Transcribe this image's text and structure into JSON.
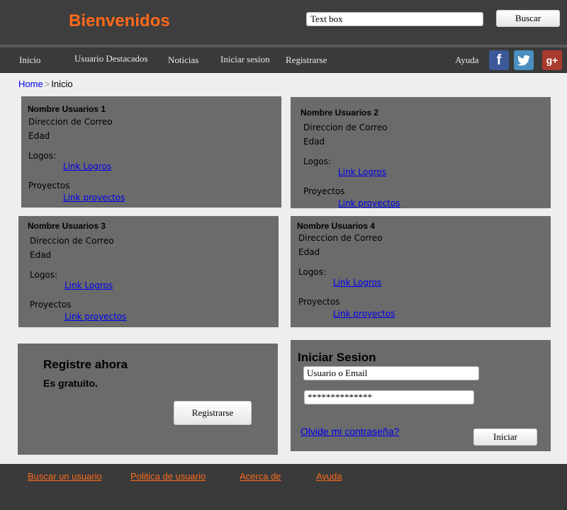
{
  "header": {
    "title": "Bienvenidos",
    "search_value": "Text box",
    "search_button": "Buscar"
  },
  "nav": {
    "items": [
      "Inicio",
      "Usuario Destacados",
      "Noticias",
      "Iniciar sesion",
      "Registrarse",
      "Ayuda"
    ],
    "social": {
      "facebook": "f",
      "twitter": "t",
      "googleplus": "g+"
    }
  },
  "breadcrumb": {
    "home": "Home",
    "separator": ">",
    "current": "Inicio"
  },
  "users": [
    {
      "name": "Nombre Usuarios 1",
      "email": "Direccion de Correo",
      "age": "Edad",
      "logros_label": "Logos:",
      "logros_link": "Link Logros",
      "proyectos_label": "Proyectos",
      "proyectos_link": "Link proyectos"
    },
    {
      "name": "Nombre Usuarios 2",
      "email": "Direccion de Correo",
      "age": "Edad",
      "logros_label": "Logos:",
      "logros_link": "Link Logros",
      "proyectos_label": "Proyectos",
      "proyectos_link": "Link proyectos"
    },
    {
      "name": "Nombre Usuarios 3",
      "email": "Direccion de Correo",
      "age": "Edad",
      "logros_label": "Logos:",
      "logros_link": "Link Logros",
      "proyectos_label": "Proyectos",
      "proyectos_link": "Link proyectos"
    },
    {
      "name": "Nombre Usuarios 4",
      "email": "Direccion de Correo",
      "age": "Edad",
      "logros_label": "Logos:",
      "logros_link": "Link Logros",
      "proyectos_label": "Proyectos",
      "proyectos_link": "Link proyectos"
    }
  ],
  "register": {
    "title": "Registre ahora",
    "subtitle": "Es gratuito.",
    "button": "Registrarse"
  },
  "login": {
    "title": "Iniciar Sesion",
    "user_value": "Usuario o Email",
    "password_value": "**************",
    "forgot": "Olvide mi contraseña?",
    "button": "Iniciar"
  },
  "footer": {
    "links": [
      "Buscar un usuario",
      "Politica de usuario",
      "Acerca de",
      "Ayuda"
    ]
  },
  "colors": {
    "accent": "#ff6a1a",
    "header_bg": "#3e3e3e",
    "card_bg": "#6b6b6b",
    "link": "#0000ee"
  }
}
